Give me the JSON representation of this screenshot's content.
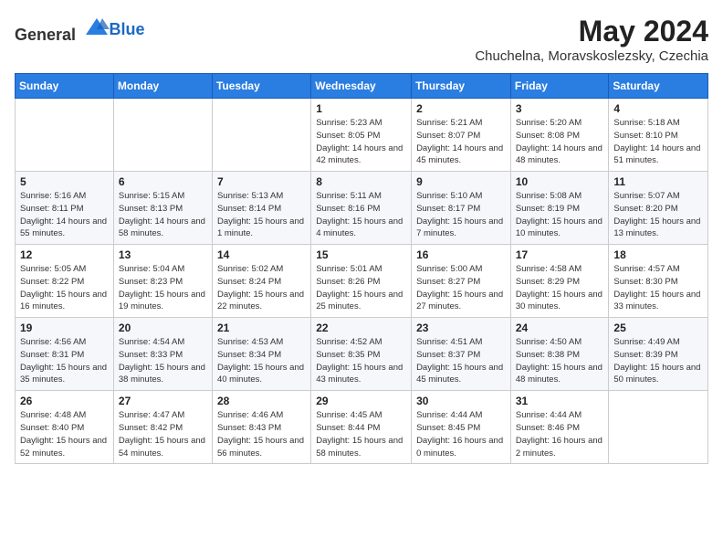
{
  "header": {
    "logo_general": "General",
    "logo_blue": "Blue",
    "month_year": "May 2024",
    "location": "Chuchelna, Moravskoslezsky, Czechia"
  },
  "days_of_week": [
    "Sunday",
    "Monday",
    "Tuesday",
    "Wednesday",
    "Thursday",
    "Friday",
    "Saturday"
  ],
  "weeks": [
    [
      {
        "day": "",
        "info": ""
      },
      {
        "day": "",
        "info": ""
      },
      {
        "day": "",
        "info": ""
      },
      {
        "day": "1",
        "info": "Sunrise: 5:23 AM\nSunset: 8:05 PM\nDaylight: 14 hours and 42 minutes."
      },
      {
        "day": "2",
        "info": "Sunrise: 5:21 AM\nSunset: 8:07 PM\nDaylight: 14 hours and 45 minutes."
      },
      {
        "day": "3",
        "info": "Sunrise: 5:20 AM\nSunset: 8:08 PM\nDaylight: 14 hours and 48 minutes."
      },
      {
        "day": "4",
        "info": "Sunrise: 5:18 AM\nSunset: 8:10 PM\nDaylight: 14 hours and 51 minutes."
      }
    ],
    [
      {
        "day": "5",
        "info": "Sunrise: 5:16 AM\nSunset: 8:11 PM\nDaylight: 14 hours and 55 minutes."
      },
      {
        "day": "6",
        "info": "Sunrise: 5:15 AM\nSunset: 8:13 PM\nDaylight: 14 hours and 58 minutes."
      },
      {
        "day": "7",
        "info": "Sunrise: 5:13 AM\nSunset: 8:14 PM\nDaylight: 15 hours and 1 minute."
      },
      {
        "day": "8",
        "info": "Sunrise: 5:11 AM\nSunset: 8:16 PM\nDaylight: 15 hours and 4 minutes."
      },
      {
        "day": "9",
        "info": "Sunrise: 5:10 AM\nSunset: 8:17 PM\nDaylight: 15 hours and 7 minutes."
      },
      {
        "day": "10",
        "info": "Sunrise: 5:08 AM\nSunset: 8:19 PM\nDaylight: 15 hours and 10 minutes."
      },
      {
        "day": "11",
        "info": "Sunrise: 5:07 AM\nSunset: 8:20 PM\nDaylight: 15 hours and 13 minutes."
      }
    ],
    [
      {
        "day": "12",
        "info": "Sunrise: 5:05 AM\nSunset: 8:22 PM\nDaylight: 15 hours and 16 minutes."
      },
      {
        "day": "13",
        "info": "Sunrise: 5:04 AM\nSunset: 8:23 PM\nDaylight: 15 hours and 19 minutes."
      },
      {
        "day": "14",
        "info": "Sunrise: 5:02 AM\nSunset: 8:24 PM\nDaylight: 15 hours and 22 minutes."
      },
      {
        "day": "15",
        "info": "Sunrise: 5:01 AM\nSunset: 8:26 PM\nDaylight: 15 hours and 25 minutes."
      },
      {
        "day": "16",
        "info": "Sunrise: 5:00 AM\nSunset: 8:27 PM\nDaylight: 15 hours and 27 minutes."
      },
      {
        "day": "17",
        "info": "Sunrise: 4:58 AM\nSunset: 8:29 PM\nDaylight: 15 hours and 30 minutes."
      },
      {
        "day": "18",
        "info": "Sunrise: 4:57 AM\nSunset: 8:30 PM\nDaylight: 15 hours and 33 minutes."
      }
    ],
    [
      {
        "day": "19",
        "info": "Sunrise: 4:56 AM\nSunset: 8:31 PM\nDaylight: 15 hours and 35 minutes."
      },
      {
        "day": "20",
        "info": "Sunrise: 4:54 AM\nSunset: 8:33 PM\nDaylight: 15 hours and 38 minutes."
      },
      {
        "day": "21",
        "info": "Sunrise: 4:53 AM\nSunset: 8:34 PM\nDaylight: 15 hours and 40 minutes."
      },
      {
        "day": "22",
        "info": "Sunrise: 4:52 AM\nSunset: 8:35 PM\nDaylight: 15 hours and 43 minutes."
      },
      {
        "day": "23",
        "info": "Sunrise: 4:51 AM\nSunset: 8:37 PM\nDaylight: 15 hours and 45 minutes."
      },
      {
        "day": "24",
        "info": "Sunrise: 4:50 AM\nSunset: 8:38 PM\nDaylight: 15 hours and 48 minutes."
      },
      {
        "day": "25",
        "info": "Sunrise: 4:49 AM\nSunset: 8:39 PM\nDaylight: 15 hours and 50 minutes."
      }
    ],
    [
      {
        "day": "26",
        "info": "Sunrise: 4:48 AM\nSunset: 8:40 PM\nDaylight: 15 hours and 52 minutes."
      },
      {
        "day": "27",
        "info": "Sunrise: 4:47 AM\nSunset: 8:42 PM\nDaylight: 15 hours and 54 minutes."
      },
      {
        "day": "28",
        "info": "Sunrise: 4:46 AM\nSunset: 8:43 PM\nDaylight: 15 hours and 56 minutes."
      },
      {
        "day": "29",
        "info": "Sunrise: 4:45 AM\nSunset: 8:44 PM\nDaylight: 15 hours and 58 minutes."
      },
      {
        "day": "30",
        "info": "Sunrise: 4:44 AM\nSunset: 8:45 PM\nDaylight: 16 hours and 0 minutes."
      },
      {
        "day": "31",
        "info": "Sunrise: 4:44 AM\nSunset: 8:46 PM\nDaylight: 16 hours and 2 minutes."
      },
      {
        "day": "",
        "info": ""
      }
    ]
  ]
}
